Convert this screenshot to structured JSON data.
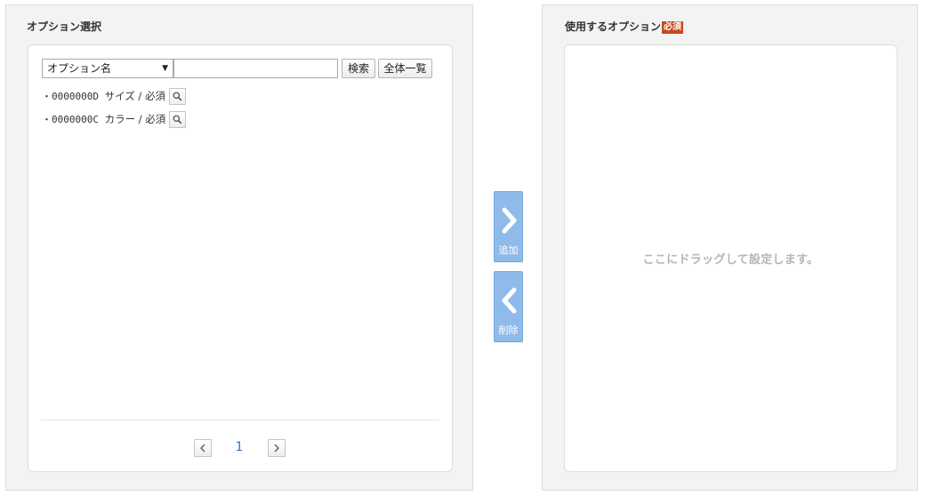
{
  "left_panel": {
    "title": "オプション選択",
    "search": {
      "field_select": "オプション名",
      "query_value": "",
      "search_button": "検索",
      "all_button": "全体一覧"
    },
    "options": [
      {
        "code": "・0000000D",
        "label": "サイズ / 必須"
      },
      {
        "code": "・0000000C",
        "label": "カラー / 必須"
      }
    ],
    "pagination": {
      "current_page": "1"
    }
  },
  "transfer": {
    "add_label": "追加",
    "remove_label": "削除"
  },
  "right_panel": {
    "title": "使用するオプション",
    "required_badge": "必須",
    "drop_hint": "ここにドラッグして設定します。"
  },
  "colors": {
    "panel_bg": "#f3f3f3",
    "arrow_button": "#8ebbe9",
    "required_badge": "#c9491c",
    "page_link": "#2f73c9"
  },
  "icons": {
    "option_detail": "magnifier-icon",
    "page_prev": "chevron-left-icon",
    "page_next": "chevron-right-icon",
    "add": "chevron-right-icon",
    "remove": "chevron-left-icon"
  }
}
